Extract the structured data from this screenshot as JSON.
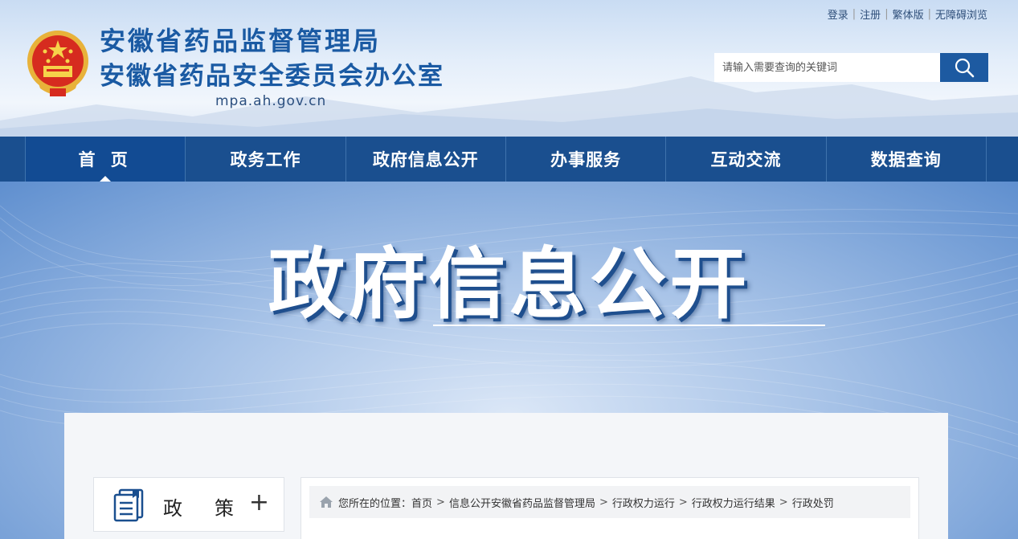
{
  "header": {
    "site_name_line1": "安徽省药品监督管理局",
    "site_name_line2": "安徽省药品安全委员会办公室",
    "domain": "mpa.ah.gov.cn",
    "top_links": [
      "登录",
      "注册",
      "繁体版",
      "无障碍浏览"
    ],
    "search": {
      "placeholder": "请输入需要查询的关键词",
      "value": ""
    }
  },
  "nav": {
    "items": [
      {
        "label": "首 页",
        "active": true
      },
      {
        "label": "政务工作"
      },
      {
        "label": "政府信息公开"
      },
      {
        "label": "办事服务"
      },
      {
        "label": "互动交流"
      },
      {
        "label": "数据查询"
      }
    ]
  },
  "banner": {
    "title": "政府信息公开"
  },
  "sidebar": {
    "label": "政策",
    "expand_symbol": "+"
  },
  "breadcrumb": {
    "prefix": "您所在的位置：",
    "items": [
      "首页",
      "信息公开安徽省药品监督管理局",
      "行政权力运行",
      "行政权力运行结果",
      "行政处罚"
    ]
  },
  "colors": {
    "brand_blue": "#1a4f8f",
    "title_blue": "#1a5aa3"
  }
}
